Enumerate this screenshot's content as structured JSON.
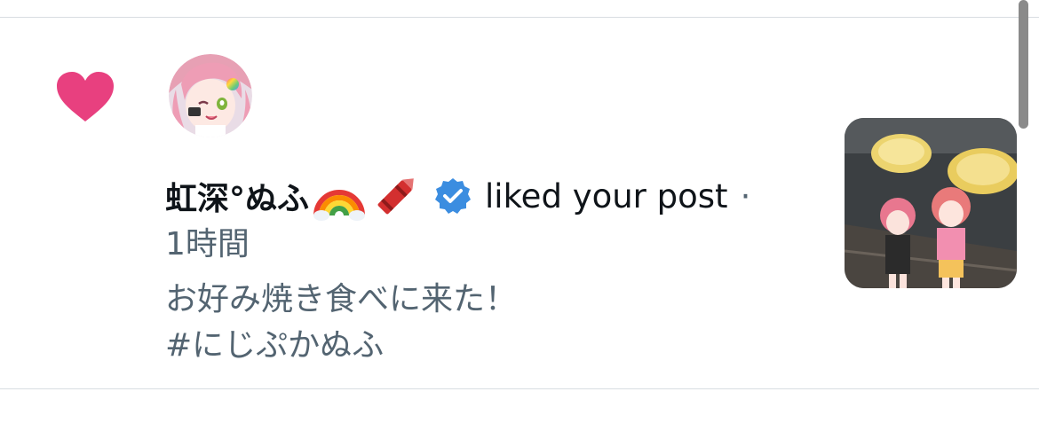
{
  "notification": {
    "type_icon": "heart-icon",
    "type_color": "#e8407f",
    "avatar": "user-avatar",
    "user_name": "虹深°ぬふ",
    "name_emojis": [
      "rainbow-emoji",
      "crayon-emoji"
    ],
    "verified": true,
    "verified_color": "#3b8de0",
    "action": "liked your post",
    "separator": "·",
    "time": "1時間",
    "post_lines": [
      "お好み焼き食べに来た！",
      "#にじぷかぬふ"
    ],
    "thumbnail": "post-image-okonomiyaki-figures"
  },
  "colors": {
    "divider": "#d8dde2",
    "primary_text": "#0f1419",
    "secondary_text": "#536471"
  }
}
